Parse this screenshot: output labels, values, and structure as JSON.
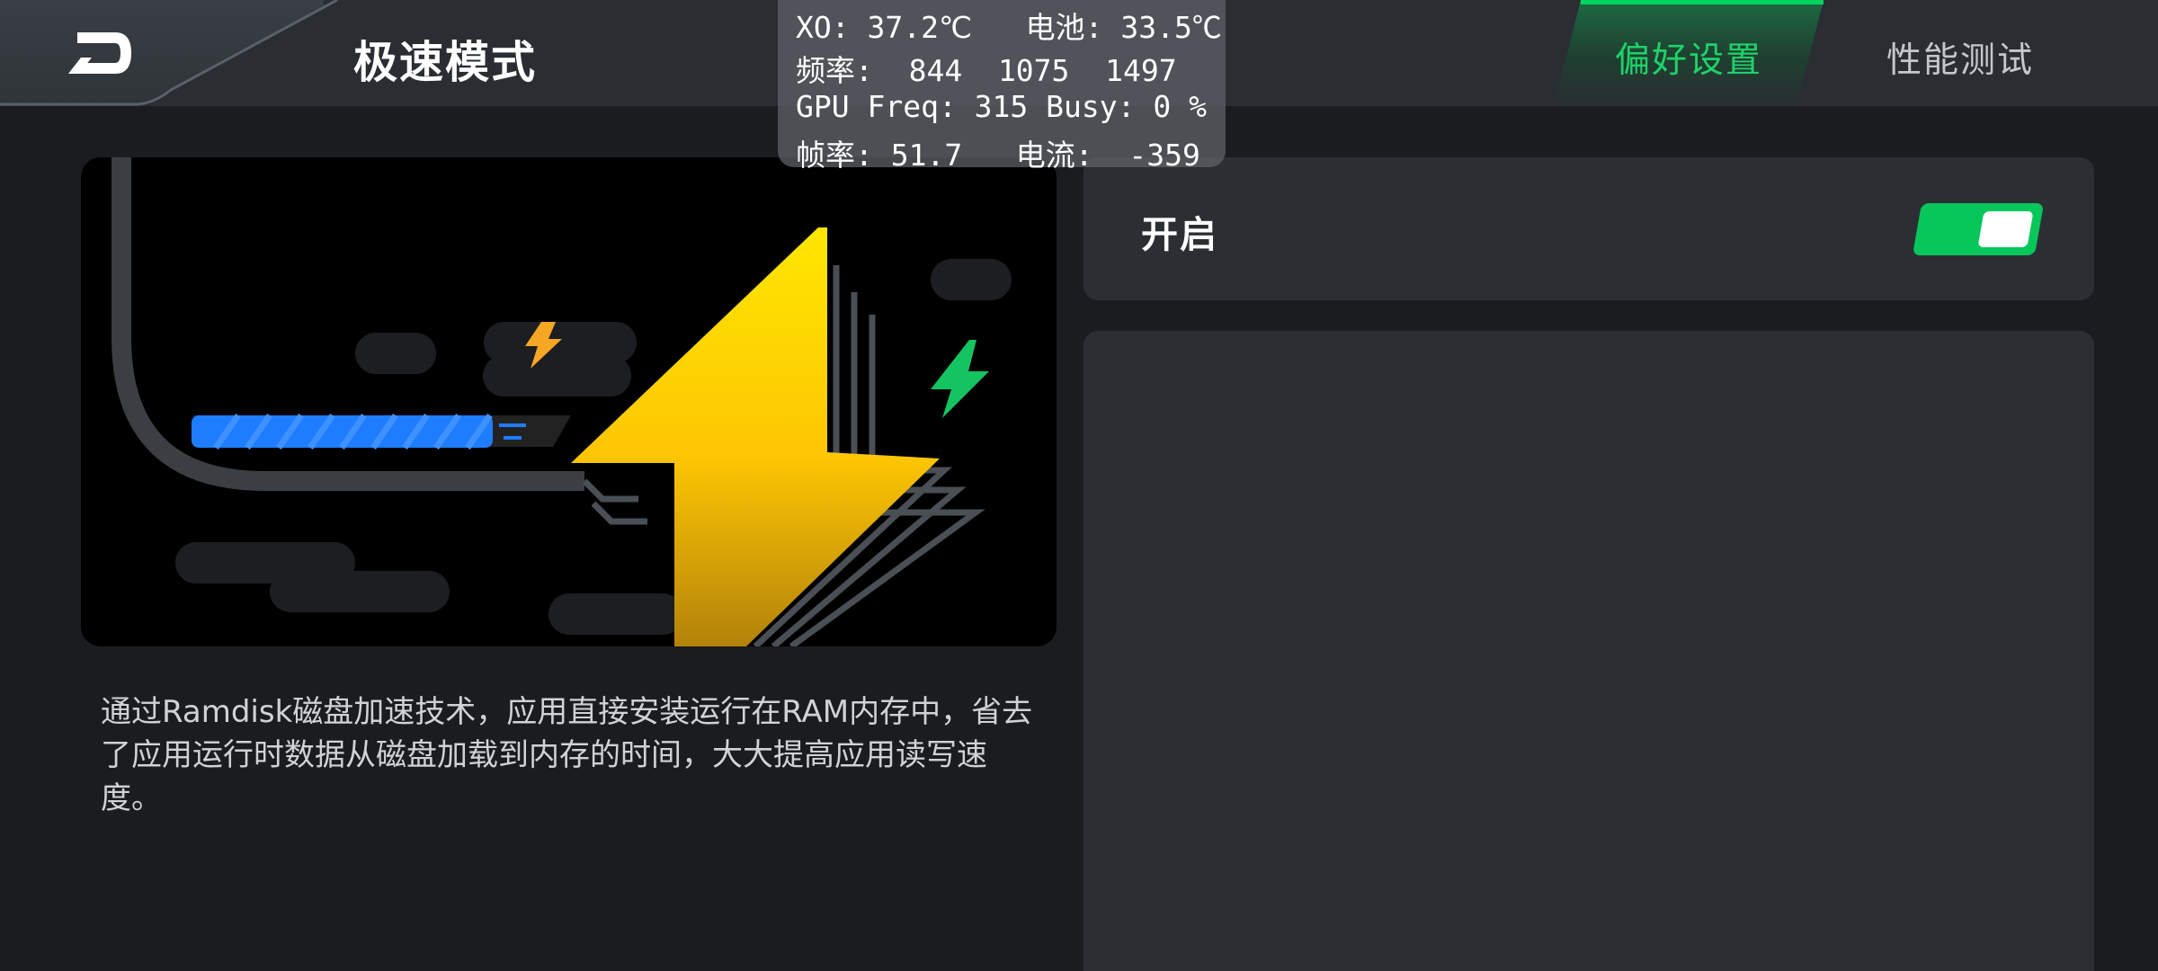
{
  "header": {
    "title": "极速模式",
    "tabs": [
      {
        "label": "偏好设置",
        "active": true
      },
      {
        "label": "性能测试",
        "active": false
      }
    ],
    "accent_color": "#00d35f"
  },
  "overlay": {
    "line1": "XO: 37.2℃   电池: 33.5℃",
    "line2": "频率:  844  1075  1497",
    "line3": "GPU Freq: 315 Busy: 0 %",
    "line4": "帧率: 51.7   电流:  -359"
  },
  "description": "通过Ramdisk磁盘加速技术，应用直接安装运行在RAM内存中，省去了应用运行时数据从磁盘加载到内存的时间，大大提高应用读写速度。",
  "setting": {
    "label": "开启",
    "enabled": true,
    "toggle_color": "#07c65a"
  }
}
